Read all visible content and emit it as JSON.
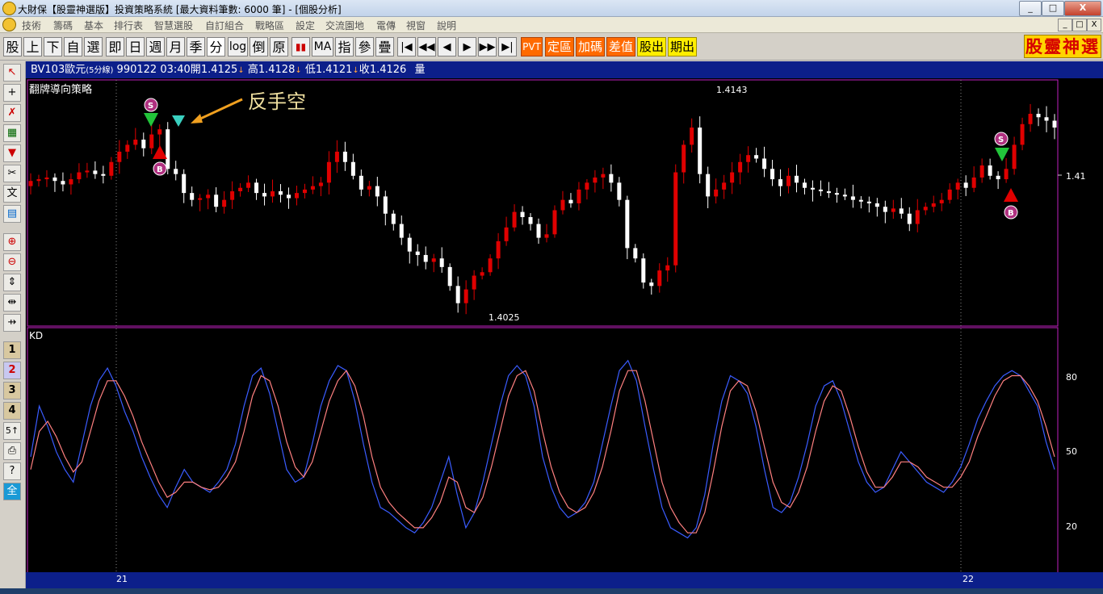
{
  "window": {
    "title": "大財保【股靈神選版】投資策略系統 [最大資料筆數: 6000 筆] - [個股分析]",
    "buttons": [
      "_",
      "□",
      "X"
    ]
  },
  "menu": {
    "items": [
      "技術",
      "籌碼",
      "基本",
      "排行表",
      "智慧選股",
      "自訂組合",
      "戰略區",
      "設定",
      "交流園地",
      "電傳",
      "視窗",
      "說明"
    ],
    "mdi_buttons": [
      "_",
      "□",
      "X"
    ]
  },
  "toolbar": {
    "buttons": [
      "股",
      "上",
      "下",
      "自",
      "選",
      "即",
      "日",
      "週",
      "月",
      "季",
      "分",
      "log",
      "倒",
      "原",
      "▮▮",
      "MA",
      "指",
      "參",
      "疊"
    ],
    "nav_buttons": [
      "|◀",
      "◀◀",
      "◀",
      "▶",
      "▶▶",
      "▶|"
    ],
    "orange_buttons": [
      "PVT",
      "定區",
      "加碼",
      "差值"
    ],
    "yellow_buttons": [
      "股出",
      "期出"
    ],
    "brand": "股靈神選"
  },
  "left_tools": [
    "↖",
    "+",
    "✗",
    "▦",
    "▼",
    "✂",
    "文",
    "▤",
    "⊕",
    "⊖",
    "⇕",
    "⇹",
    "⇸",
    "1",
    "2",
    "3",
    "4",
    "5↑",
    "⎙",
    "?",
    "全"
  ],
  "info": {
    "symbol": "BV103歐元",
    "period": "(5分線)",
    "date": "990122",
    "time": "03:40",
    "open_label": "開",
    "open": "1.4125",
    "high_label": "高",
    "high": "1.4128",
    "low_label": "低",
    "low": "1.4121",
    "close_label": "收",
    "close": "1.4126",
    "volume_label": "量",
    "arrow": "↓"
  },
  "price_panel": {
    "title": "翻牌導向策略",
    "annotation": "反手空",
    "high_label": "1.4143",
    "low_label": "1.4025",
    "yaxis_label": "1.41",
    "signal_sell": "S",
    "signal_buy": "B"
  },
  "kd_panel": {
    "title": "KD",
    "ticks": [
      "80",
      "50",
      "20"
    ]
  },
  "xaxis": {
    "labels": [
      "21",
      "22"
    ]
  },
  "colors": {
    "background": "#000000",
    "up_candle": "#e00000",
    "down_candle": "#ffffff",
    "k_line": "#3a5cff",
    "d_line": "#ff8080",
    "panel_border": "#c020c0",
    "info_bar": "#0c1f8a",
    "sell_marker": "#22c43a",
    "buy_marker": "#e00000",
    "annotation_arrow": "#f0a020"
  },
  "chart_data": [
    {
      "type": "candlestick",
      "title": "翻牌導向策略",
      "ylim": [
        1.402,
        1.4155
      ],
      "y_ticks": [
        1.41
      ],
      "x_labels": [
        "21",
        "22"
      ],
      "close": [
        1.4101,
        1.4102,
        1.4103,
        1.4101,
        1.4099,
        1.4102,
        1.4106,
        1.4107,
        1.4105,
        1.4104,
        1.4112,
        1.4118,
        1.4122,
        1.4125,
        1.412,
        1.4128,
        1.4131,
        1.4108,
        1.4105,
        1.4094,
        1.409,
        1.4091,
        1.4093,
        1.4086,
        1.409,
        1.4095,
        1.4097,
        1.41,
        1.4094,
        1.4092,
        1.4095,
        1.4093,
        1.4091,
        1.4094,
        1.4096,
        1.4098,
        1.41,
        1.4112,
        1.4118,
        1.4112,
        1.4104,
        1.4096,
        1.4098,
        1.4092,
        1.4082,
        1.4076,
        1.4068,
        1.406,
        1.4058,
        1.4054,
        1.4056,
        1.4051,
        1.404,
        1.403,
        1.4038,
        1.4046,
        1.4048,
        1.4056,
        1.4066,
        1.4074,
        1.4083,
        1.408,
        1.4076,
        1.4068,
        1.407,
        1.4084,
        1.409,
        1.4088,
        1.4096,
        1.41,
        1.4103,
        1.4105,
        1.41,
        1.409,
        1.4062,
        1.4056,
        1.4042,
        1.404,
        1.4049,
        1.4052,
        1.4106,
        1.4122,
        1.4132,
        1.4105,
        1.4092,
        1.4096,
        1.41,
        1.4106,
        1.4112,
        1.4116,
        1.4114,
        1.4108,
        1.4102,
        1.4098,
        1.4104,
        1.41,
        1.4097,
        1.4096,
        1.4095,
        1.4094,
        1.4093,
        1.4092,
        1.409,
        1.4089,
        1.4088,
        1.4086,
        1.4083,
        1.4085,
        1.4082,
        1.4076,
        1.4084,
        1.4086,
        1.4088,
        1.409,
        1.4096,
        1.41,
        1.4097,
        1.4103,
        1.411,
        1.4104,
        1.4102,
        1.4108,
        1.4122,
        1.4134,
        1.414,
        1.4138,
        1.4136,
        1.4132
      ]
    },
    {
      "type": "line",
      "title": "KD",
      "ylim": [
        0,
        100
      ],
      "y_ticks": [
        20,
        50,
        80
      ],
      "series": [
        {
          "name": "K",
          "values": [
            50,
            70,
            62,
            52,
            45,
            40,
            55,
            70,
            80,
            85,
            78,
            68,
            60,
            50,
            42,
            35,
            30,
            38,
            45,
            40,
            38,
            36,
            40,
            45,
            55,
            70,
            82,
            85,
            75,
            60,
            45,
            40,
            42,
            55,
            70,
            80,
            86,
            84,
            72,
            55,
            40,
            30,
            28,
            25,
            22,
            20,
            24,
            30,
            40,
            50,
            35,
            22,
            28,
            40,
            55,
            70,
            82,
            86,
            82,
            70,
            50,
            38,
            30,
            26,
            28,
            32,
            40,
            55,
            70,
            84,
            88,
            80,
            62,
            45,
            30,
            22,
            20,
            18,
            22,
            35,
            55,
            72,
            82,
            80,
            75,
            62,
            45,
            30,
            28,
            32,
            42,
            55,
            70,
            78,
            80,
            72,
            60,
            48,
            40,
            36,
            38,
            45,
            52,
            48,
            44,
            40,
            38,
            36,
            40,
            46,
            55,
            65,
            72,
            78,
            82,
            84,
            82,
            76,
            70,
            56,
            45
          ]
        },
        {
          "name": "D",
          "values": [
            45,
            60,
            64,
            58,
            50,
            44,
            48,
            60,
            72,
            80,
            80,
            74,
            66,
            56,
            48,
            40,
            34,
            36,
            40,
            40,
            38,
            37,
            38,
            42,
            48,
            60,
            74,
            82,
            80,
            70,
            56,
            46,
            42,
            48,
            60,
            72,
            80,
            84,
            78,
            66,
            50,
            38,
            32,
            28,
            25,
            22,
            22,
            26,
            32,
            42,
            40,
            30,
            28,
            34,
            46,
            60,
            74,
            82,
            84,
            76,
            60,
            46,
            36,
            30,
            28,
            30,
            36,
            46,
            60,
            76,
            84,
            84,
            72,
            56,
            40,
            30,
            24,
            20,
            20,
            28,
            44,
            62,
            76,
            80,
            78,
            68,
            54,
            40,
            32,
            30,
            36,
            46,
            60,
            72,
            78,
            76,
            66,
            54,
            44,
            38,
            38,
            42,
            48,
            48,
            46,
            42,
            40,
            38,
            38,
            42,
            48,
            58,
            66,
            74,
            80,
            82,
            82,
            78,
            72,
            62,
            50
          ]
        }
      ]
    }
  ]
}
